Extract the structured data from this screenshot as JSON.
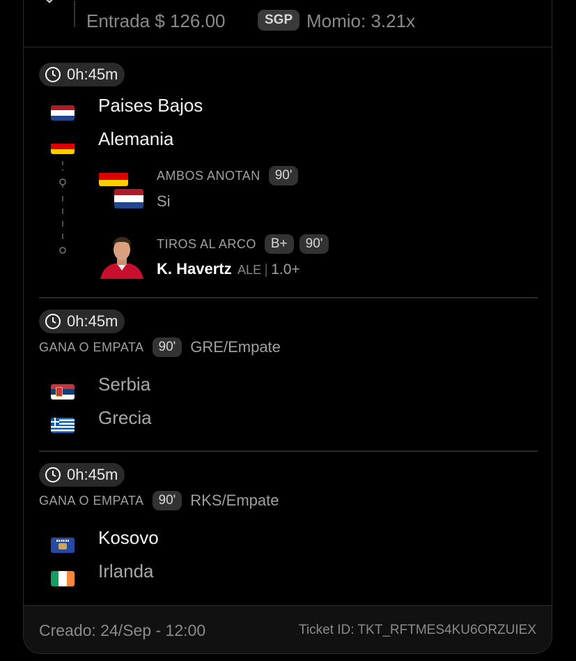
{
  "header": {
    "entry": "Entrada $ 126.00",
    "badge": "SGP",
    "odds": "Momio: 3.21x"
  },
  "bets": [
    {
      "timer": "0h:45m",
      "teams": [
        {
          "name": "Paises Bajos",
          "flag": "netherlands-flag"
        },
        {
          "name": "Alemania",
          "flag": "germany-flag"
        }
      ],
      "legs": [
        {
          "market": "AMBOS ANOTAN",
          "period": "90'",
          "pick": "Si"
        },
        {
          "market": "TIROS AL ARCO",
          "tag": "B+",
          "period": "90'",
          "player": "K. Havertz",
          "team_abbr": "ALE",
          "separator": "|",
          "line": "1.0+"
        }
      ]
    },
    {
      "timer": "0h:45m",
      "market": "GANA O EMPATA",
      "period": "90'",
      "pick": "GRE/Empate",
      "teams": [
        {
          "name": "Serbia",
          "flag": "serbia-flag"
        },
        {
          "name": "Grecia",
          "flag": "greece-flag"
        }
      ]
    },
    {
      "timer": "0h:45m",
      "market": "GANA O EMPATA",
      "period": "90'",
      "pick": "RKS/Empate",
      "teams": [
        {
          "name": "Kosovo",
          "flag": "kosovo-flag"
        },
        {
          "name": "Irlanda",
          "flag": "ireland-flag"
        }
      ]
    }
  ],
  "footer": {
    "created": "Creado: 24/Sep - 12:00",
    "ticket": "Ticket ID: TKT_RFTMES4KU6ORZUIEX"
  }
}
